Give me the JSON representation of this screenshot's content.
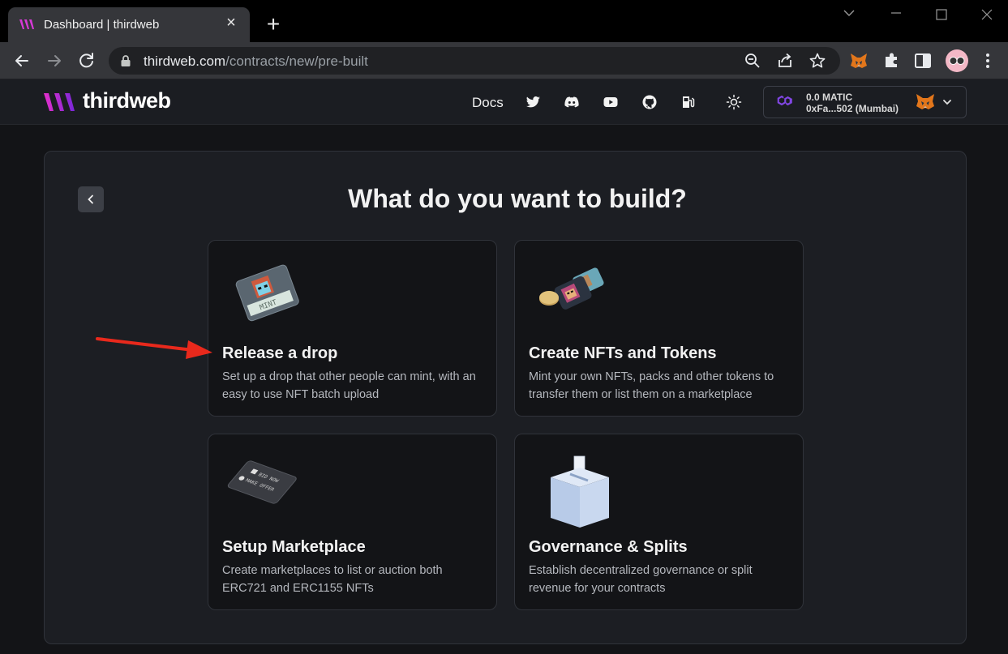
{
  "browser": {
    "tab_title": "Dashboard | thirdweb",
    "url_host": "thirdweb.com",
    "url_path": "/contracts/new/pre-built"
  },
  "site": {
    "logo_text": "thirdweb",
    "nav_docs": "Docs",
    "nav_icons": [
      "twitter-icon",
      "discord-icon",
      "youtube-icon",
      "github-icon",
      "gas-pump-icon",
      "sun-icon"
    ],
    "wallet": {
      "balance": "0.0 MATIC",
      "address": "0xFa...502 (Mumbai)"
    }
  },
  "main": {
    "title": "What do you want to build?",
    "cards": [
      {
        "title": "Release a drop",
        "description": "Set up a drop that other people can mint, with an easy to use NFT batch upload",
        "art": "mint-card-art"
      },
      {
        "title": "Create NFTs and Tokens",
        "description": "Mint your own NFTs, packs and other tokens to transfer them or list them on a marketplace",
        "art": "nft-tokens-art"
      },
      {
        "title": "Setup Marketplace",
        "description": "Create marketplaces to list or auction both ERC721 and ERC1155 NFTs",
        "art": "marketplace-card-art",
        "art_labels": [
          "BID NOW",
          "MAKE OFFER"
        ]
      },
      {
        "title": "Governance & Splits",
        "description": "Establish decentralized governance or split revenue for your contracts",
        "art": "ballot-box-art"
      }
    ]
  },
  "colors": {
    "brand_gradient_start": "#c026d3",
    "brand_gradient_end": "#6d28d9",
    "annotation_arrow": "#e8291c",
    "polygon_purple": "#8247e5"
  }
}
